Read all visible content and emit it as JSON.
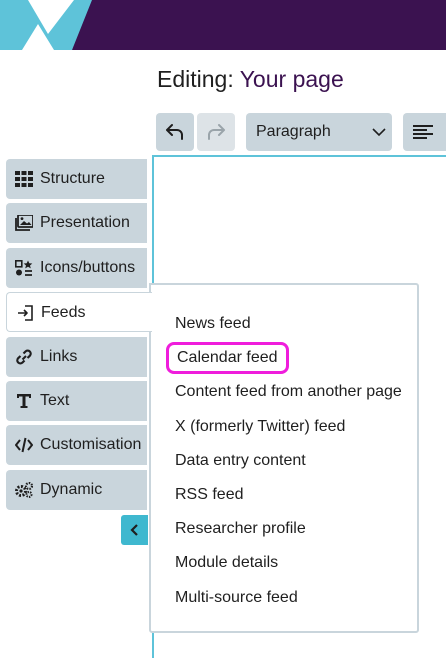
{
  "header": {
    "title_prefix": "Editing:",
    "title_name": "Your page",
    "brand_color": "#3b1250",
    "logo_color": "#5ec3d9"
  },
  "toolbar": {
    "undo_icon": "undo-icon",
    "redo_icon": "redo-icon",
    "format_value": "Paragraph",
    "align_icon": "align-left-icon"
  },
  "sidebar": {
    "items": [
      {
        "label": "Structure",
        "icon": "grid-icon"
      },
      {
        "label": "Presentation",
        "icon": "images-icon"
      },
      {
        "label": "Icons/buttons",
        "icon": "icons-buttons-icon"
      },
      {
        "label": "Feeds",
        "icon": "feed-import-icon",
        "active": true
      },
      {
        "label": "Links",
        "icon": "link-icon"
      },
      {
        "label": "Text",
        "icon": "text-icon"
      },
      {
        "label": "Customisation",
        "icon": "code-icon"
      },
      {
        "label": "Dynamic",
        "icon": "gears-icon"
      }
    ],
    "collapse_icon": "chevron-left-icon"
  },
  "feeds_menu": {
    "items": [
      "News feed",
      "Calendar feed",
      "Content feed from another page",
      "X (formerly Twitter) feed",
      "Data entry content",
      "RSS feed",
      "Researcher profile",
      "Module details",
      "Multi-source feed"
    ],
    "highlighted": "Calendar feed",
    "highlight_color": "#ef1ddc"
  }
}
